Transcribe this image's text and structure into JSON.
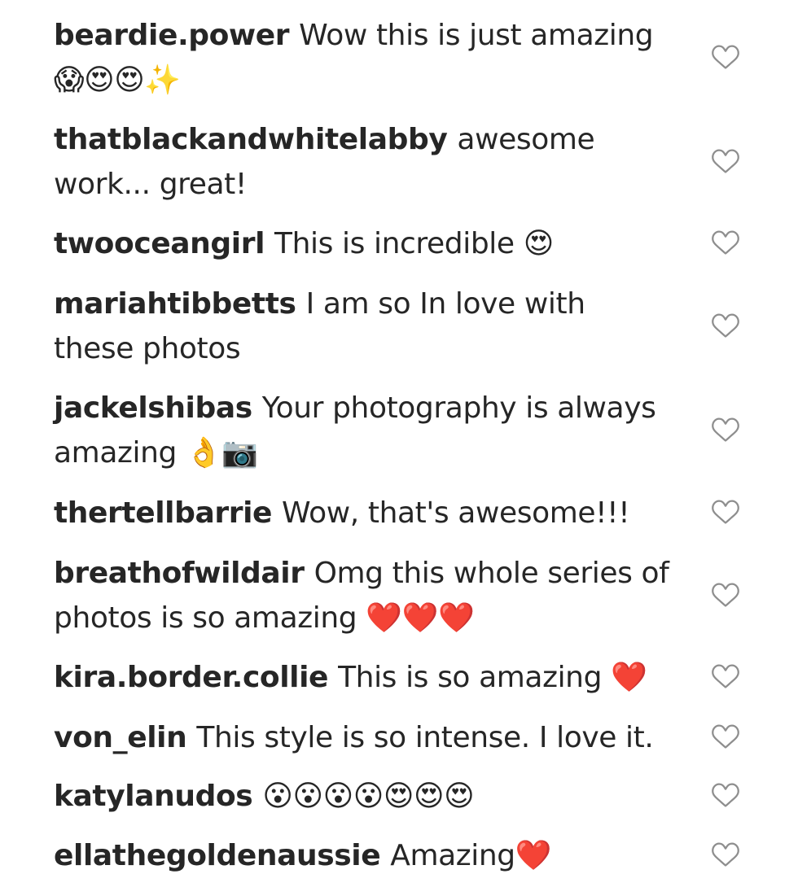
{
  "comments": [
    {
      "username": "beardie.power",
      "text": "Wow this is just amazing 😱😍😍✨",
      "like_icon": "heart-outline-icon"
    },
    {
      "username": "thatblackandwhitelabby",
      "text": "awesome work... great!",
      "like_icon": "heart-outline-icon"
    },
    {
      "username": "twooceangirl",
      "text": "This is incredible 😍",
      "like_icon": "heart-outline-icon"
    },
    {
      "username": "mariahtibbetts",
      "text": "I am so In love with these photos",
      "like_icon": "heart-outline-icon"
    },
    {
      "username": "jackelshibas",
      "text": "Your photography is always amazing 👌📷",
      "like_icon": "heart-outline-icon"
    },
    {
      "username": "thertellbarrie",
      "text": "Wow, that's awesome!!!",
      "like_icon": "heart-outline-icon"
    },
    {
      "username": "breathofwildair",
      "text": "Omg this whole series of photos is so amazing ❤️❤️❤️",
      "like_icon": "heart-outline-icon"
    },
    {
      "username": "kira.border.collie",
      "text": "This is so amazing ❤️",
      "like_icon": "heart-outline-icon"
    },
    {
      "username": "von_elin",
      "text": "This style is so intense. I love it.",
      "like_icon": "heart-outline-icon"
    },
    {
      "username": "katylanudos",
      "text": "😮😮😮😮😍😍😍",
      "like_icon": "heart-outline-icon"
    },
    {
      "username": "ellathegoldenaussie",
      "text": "Amazing❤️",
      "like_icon": "heart-outline-icon"
    }
  ],
  "colors": {
    "text": "#262626",
    "heart_outline": "#8e8e8e",
    "background": "#ffffff"
  }
}
